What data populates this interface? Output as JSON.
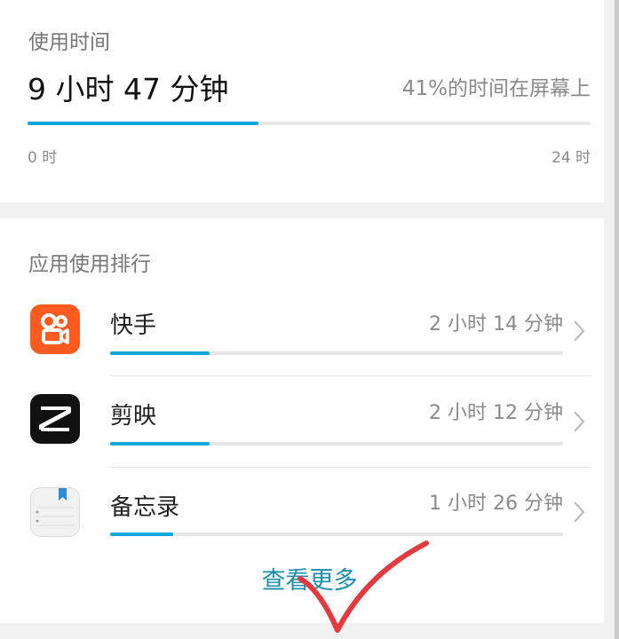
{
  "usage": {
    "title": "使用时间",
    "total": "9 小时 47 分钟",
    "screen_percent": "41%的时间在屏幕上",
    "progress_fraction": 0.41,
    "tick_start": "0 时",
    "tick_end": "24 时"
  },
  "ranking": {
    "title": "应用使用排行",
    "apps": [
      {
        "name": "快手",
        "time": "2 小时 14 分钟",
        "icon": "kuaishou-icon",
        "fraction": 0.22,
        "color": "#ff5a1f"
      },
      {
        "name": "剪映",
        "time": "2 小时 12 分钟",
        "icon": "capcut-icon",
        "fraction": 0.22,
        "color": "#111111"
      },
      {
        "name": "备忘录",
        "time": "1 小时 26 分钟",
        "icon": "notes-icon",
        "fraction": 0.14,
        "color": "#f2f2f2"
      }
    ],
    "more_label": "查看更多"
  },
  "accent_color": "#12a8d8",
  "annotation_color": "#e33a3f"
}
